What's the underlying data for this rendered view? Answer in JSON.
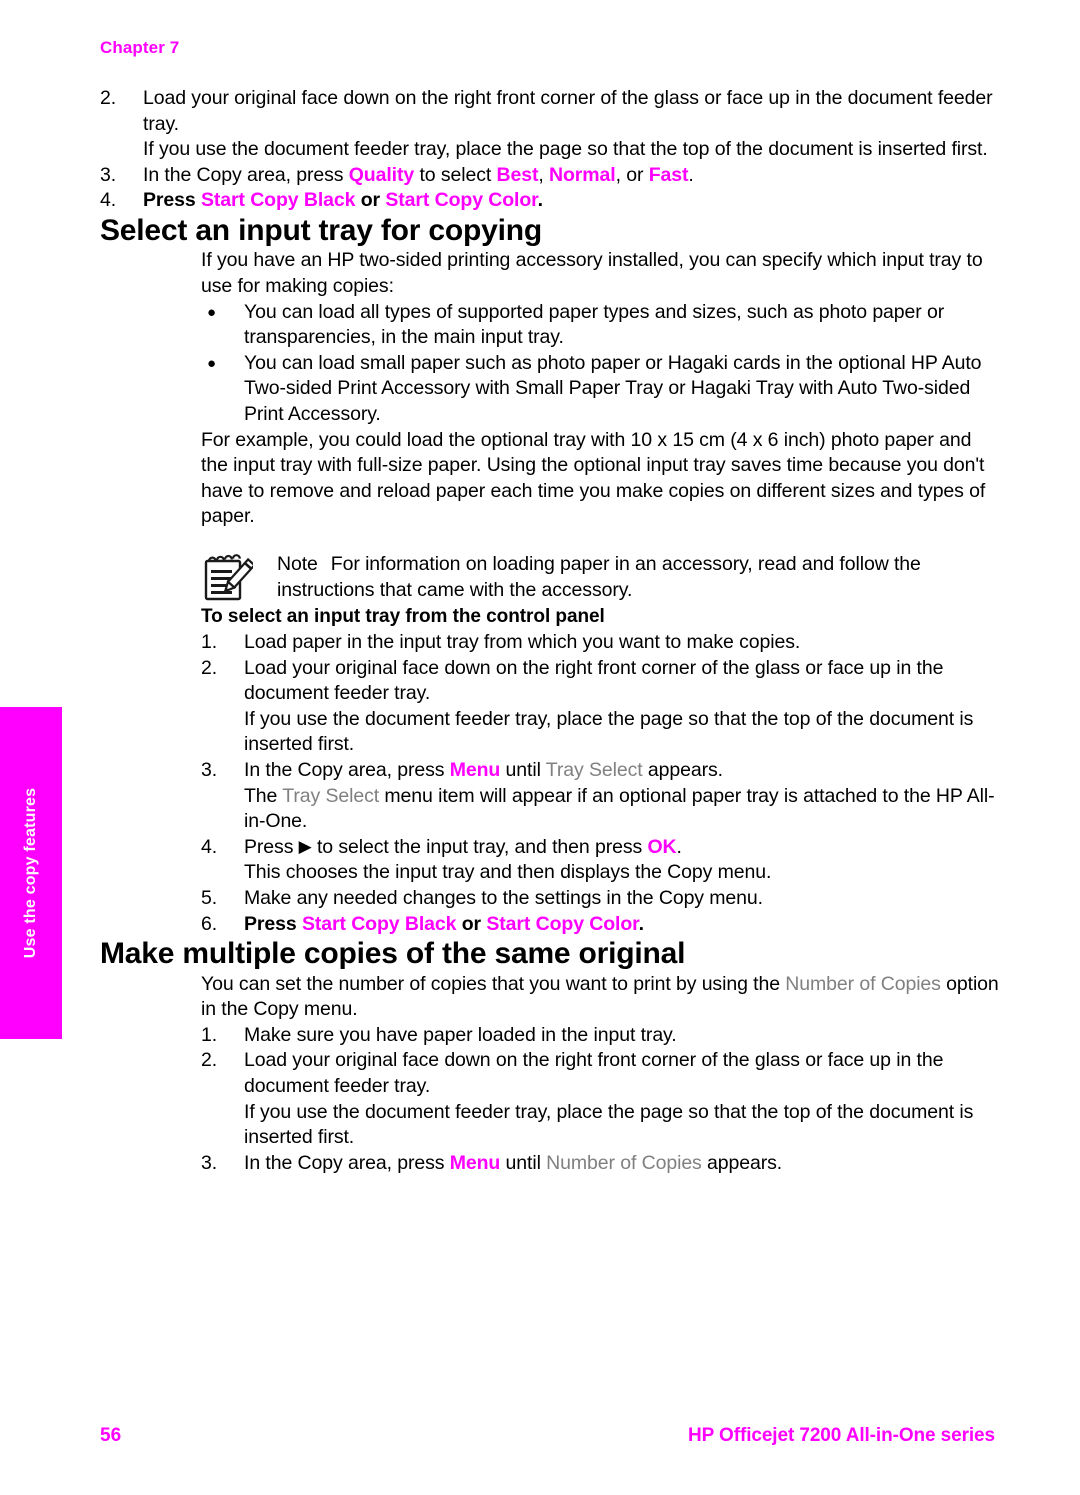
{
  "header": {
    "chapter_label": "Chapter 7"
  },
  "side_tab": {
    "label": "Use the copy features",
    "background_color": "#ff00ff",
    "text_color": "#ffffff"
  },
  "colors": {
    "ui_key_magenta": "#ff00ff",
    "ui_screen_gray": "#808080",
    "body_black": "#000000"
  },
  "top_steps": {
    "items": [
      {
        "number": "2.",
        "lines": [
          "Load your original face down on the right front corner of the glass or face up in the document feeder tray.",
          "If you use the document feeder tray, place the page so that the top of the document is inserted first."
        ]
      },
      {
        "number": "3.",
        "segments": [
          {
            "text": "In the Copy area, press ",
            "style": "plain"
          },
          {
            "text": "Quality",
            "style": "key"
          },
          {
            "text": " to select ",
            "style": "plain"
          },
          {
            "text": "Best",
            "style": "key"
          },
          {
            "text": ", ",
            "style": "plain"
          },
          {
            "text": "Normal",
            "style": "key"
          },
          {
            "text": ", or ",
            "style": "plain"
          },
          {
            "text": "Fast",
            "style": "key"
          },
          {
            "text": ".",
            "style": "plain"
          }
        ]
      },
      {
        "number": "4.",
        "segments": [
          {
            "text": "Press ",
            "style": "key"
          },
          {
            "text": "Start Copy Black",
            "style": "key"
          },
          {
            "text": " or ",
            "style": "plain-bold"
          },
          {
            "text": "Start Copy Color",
            "style": "key"
          },
          {
            "text": ".",
            "style": "plain-bold"
          }
        ]
      }
    ]
  },
  "section_one": {
    "title": "Select an input tray for copying",
    "intro": "If you have an HP two-sided printing accessory installed, you can specify which input tray to use for making copies:",
    "bullets": [
      "You can load all types of supported paper types and sizes, such as photo paper or transparencies, in the main input tray.",
      "You can load small paper such as photo paper or Hagaki cards in the optional HP Auto Two-sided Print Accessory with Small Paper Tray or Hagaki Tray with Auto Two-sided Print Accessory."
    ],
    "bullet_marker": "●",
    "example_paragraph": "For example, you could load the optional tray with 10 x 15 cm (4 x 6 inch) photo paper and the input tray with full-size paper. Using the optional input tray saves time because you don't have to remove and reload paper each time you make copies on different sizes and types of paper.",
    "note": {
      "icon_name": "note-pad-pencil-icon",
      "label": "Note",
      "text": "For information on loading paper in an accessory, read and follow the instructions that came with the accessory."
    },
    "sub_heading": "To select an input tray from the control panel",
    "steps": [
      {
        "number": "1.",
        "lines": [
          "Load paper in the input tray from which you want to make copies."
        ]
      },
      {
        "number": "2.",
        "lines": [
          "Load your original face down on the right front corner of the glass or face up in the document feeder tray.",
          "If you use the document feeder tray, place the page so that the top of the document is inserted first."
        ]
      },
      {
        "number": "3.",
        "segments": [
          {
            "text": "In the Copy area, press ",
            "style": "plain"
          },
          {
            "text": "Menu",
            "style": "key"
          },
          {
            "text": " until ",
            "style": "plain"
          },
          {
            "text": "Tray Select",
            "style": "screen"
          },
          {
            "text": " appears.",
            "style": "plain"
          }
        ],
        "sub_segments": [
          {
            "text": "The ",
            "style": "plain"
          },
          {
            "text": "Tray Select",
            "style": "screen"
          },
          {
            "text": " menu item will appear if an optional paper tray is attached to the HP All-in-One.",
            "style": "plain"
          }
        ]
      },
      {
        "number": "4.",
        "segments": [
          {
            "text": "Press ",
            "style": "plain"
          },
          {
            "text": "▶",
            "style": "arrow"
          },
          {
            "text": " to select the input tray, and then press ",
            "style": "plain"
          },
          {
            "text": "OK",
            "style": "key"
          },
          {
            "text": ".",
            "style": "plain"
          }
        ],
        "sub_segments": [
          {
            "text": "This chooses the input tray and then displays the Copy menu.",
            "style": "plain"
          }
        ]
      },
      {
        "number": "5.",
        "lines": [
          "Make any needed changes to the settings in the Copy menu."
        ]
      },
      {
        "number": "6.",
        "segments": [
          {
            "text": "Press ",
            "style": "key"
          },
          {
            "text": "Start Copy Black",
            "style": "key"
          },
          {
            "text": " or ",
            "style": "plain-bold"
          },
          {
            "text": "Start Copy Color",
            "style": "key"
          },
          {
            "text": ".",
            "style": "plain-bold"
          }
        ]
      }
    ]
  },
  "section_two": {
    "title": "Make multiple copies of the same original",
    "intro_segments": [
      {
        "text": "You can set the number of copies that you want to print by using the ",
        "style": "plain"
      },
      {
        "text": "Number of Copies",
        "style": "screen"
      },
      {
        "text": " option in the Copy menu.",
        "style": "plain"
      }
    ],
    "steps": [
      {
        "number": "1.",
        "lines": [
          "Make sure you have paper loaded in the input tray."
        ]
      },
      {
        "number": "2.",
        "lines": [
          "Load your original face down on the right front corner of the glass or face up in the document feeder tray.",
          "If you use the document feeder tray, place the page so that the top of the document is inserted first."
        ]
      },
      {
        "number": "3.",
        "segments": [
          {
            "text": "In the Copy area, press ",
            "style": "plain"
          },
          {
            "text": "Menu",
            "style": "key"
          },
          {
            "text": " until ",
            "style": "plain"
          },
          {
            "text": "Number of Copies",
            "style": "screen"
          },
          {
            "text": " appears.",
            "style": "plain"
          }
        ]
      }
    ]
  },
  "footer": {
    "page_number": "56",
    "product_title": "HP Officejet 7200 All-in-One series"
  }
}
